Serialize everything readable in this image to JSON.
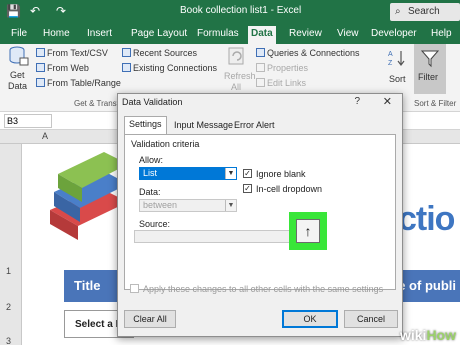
{
  "titlebar": {
    "doc_title": "Book collection list1 - Excel",
    "search_label": "Search",
    "save_glyph": "💾",
    "undo_glyph": "↶",
    "redo_glyph": "↷"
  },
  "ribbon_tabs": [
    "File",
    "Home",
    "Insert",
    "Page Layout",
    "Formulas",
    "Data",
    "Review",
    "View",
    "Developer",
    "Help"
  ],
  "ribbon": {
    "get_data_top": "Get",
    "get_data_bottom": "Data",
    "from_text": "From Text/CSV",
    "from_web": "From Web",
    "from_table": "From Table/Range",
    "recent_sources": "Recent Sources",
    "existing_connections": "Existing Connections",
    "group_get_transform": "Get & Transform Data",
    "refresh_top": "Refresh",
    "refresh_bottom": "All",
    "queries": "Queries & Connections",
    "properties": "Properties",
    "edit_links": "Edit Links",
    "sort": "Sort",
    "filter": "Filter",
    "group_sort_filter": "Sort & Filter"
  },
  "formula_bar": {
    "name_box": "B3"
  },
  "sheet": {
    "col_a": "A",
    "row_labels": [
      "1",
      "2",
      "3"
    ],
    "title_cell": "Title",
    "title_band_right": "e of publi",
    "select_cell": "Select a B",
    "big_text": "ctio"
  },
  "dialog": {
    "title": "Data Validation",
    "help": "?",
    "close": "✕",
    "tabs": [
      "Settings",
      "Input Message",
      "Error Alert"
    ],
    "criteria_label": "Validation criteria",
    "allow_label": "Allow:",
    "allow_value": "List",
    "data_label": "Data:",
    "data_value": "between",
    "ignore_blank": "Ignore blank",
    "in_cell_dropdown": "In-cell dropdown",
    "source_label": "Source:",
    "apply_changes": "Apply these changes to all other cells with the same settings",
    "clear_all": "Clear All",
    "ok": "OK",
    "cancel": "Cancel"
  },
  "watermark": {
    "wiki": "wiki",
    "how": "How"
  },
  "colors": {
    "excel_green": "#217346",
    "accent_blue": "#0078d7",
    "highlight_green": "#39e639",
    "table_blue": "#4a75b9"
  }
}
